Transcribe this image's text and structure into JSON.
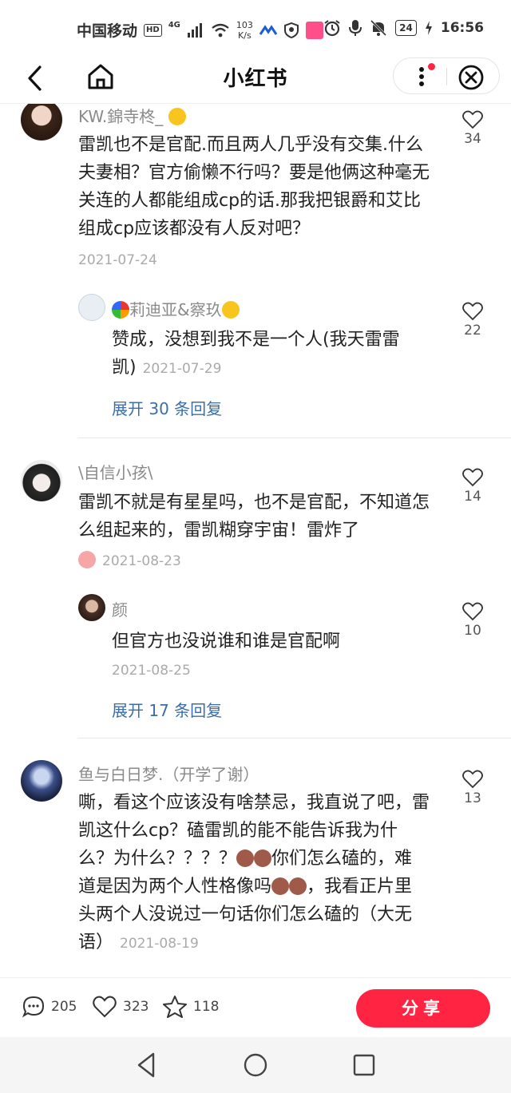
{
  "status_bar": {
    "carrier": "中国移动",
    "hd": "HD",
    "signal_label": "4G",
    "speed_value": "103",
    "speed_unit": "K/s",
    "battery": "24",
    "time": "16:56"
  },
  "header": {
    "title": "小红书",
    "icons": [
      "back-icon",
      "home-icon",
      "more-icon",
      "close-icon"
    ]
  },
  "comments": [
    {
      "username": "KW.錦寺柊_",
      "text": "雷凯也不是官配.而且两人几乎没有交集.什么夫妻相？官方偷懒不行吗？要是他俩这种毫无关连的人都能组成cp的话.那我把银爵和艾比组成cp应该都没有人反对吧？",
      "date": "2021-07-24",
      "likes": "34",
      "reply": {
        "username": "莉迪亚&察玖",
        "text": "赞成，没想到我不是一个人(我天雷雷凯)",
        "date": "2021-07-29",
        "likes": "22"
      },
      "expand": "展开 30 条回复"
    },
    {
      "username": "\\自信小孩\\",
      "text": "雷凯不就是有星星吗，也不是官配，不知道怎么组起来的，雷凯糊穿宇宙！雷炸了",
      "date": "2021-08-23",
      "likes": "14",
      "reply": {
        "username": "颜",
        "text": "但官方也没说谁和谁是官配啊",
        "date": "2021-08-25",
        "likes": "10"
      },
      "expand": "展开 17 条回复"
    },
    {
      "username": "鱼与白日梦.（开学了谢）",
      "text_1": "嘶，看这个应该没有啥禁忌，我直说了吧，雷凯这什么cp？磕雷凯的能不能告诉我为什么？为什么？？？？",
      "text_2": "你们怎么磕的，难道是因为两个人性格像吗",
      "text_3": "，我看正片里头两个人没说过一句话你们怎么磕的（大无语）",
      "date": "2021-08-19",
      "likes": "13"
    }
  ],
  "bottom_bar": {
    "comments_count": "205",
    "likes_count": "323",
    "favorites_count": "118",
    "share_label": "分享"
  },
  "colors": {
    "accent": "#ff2442",
    "link": "#3b6ea8",
    "meta": "#aaaaaa"
  }
}
